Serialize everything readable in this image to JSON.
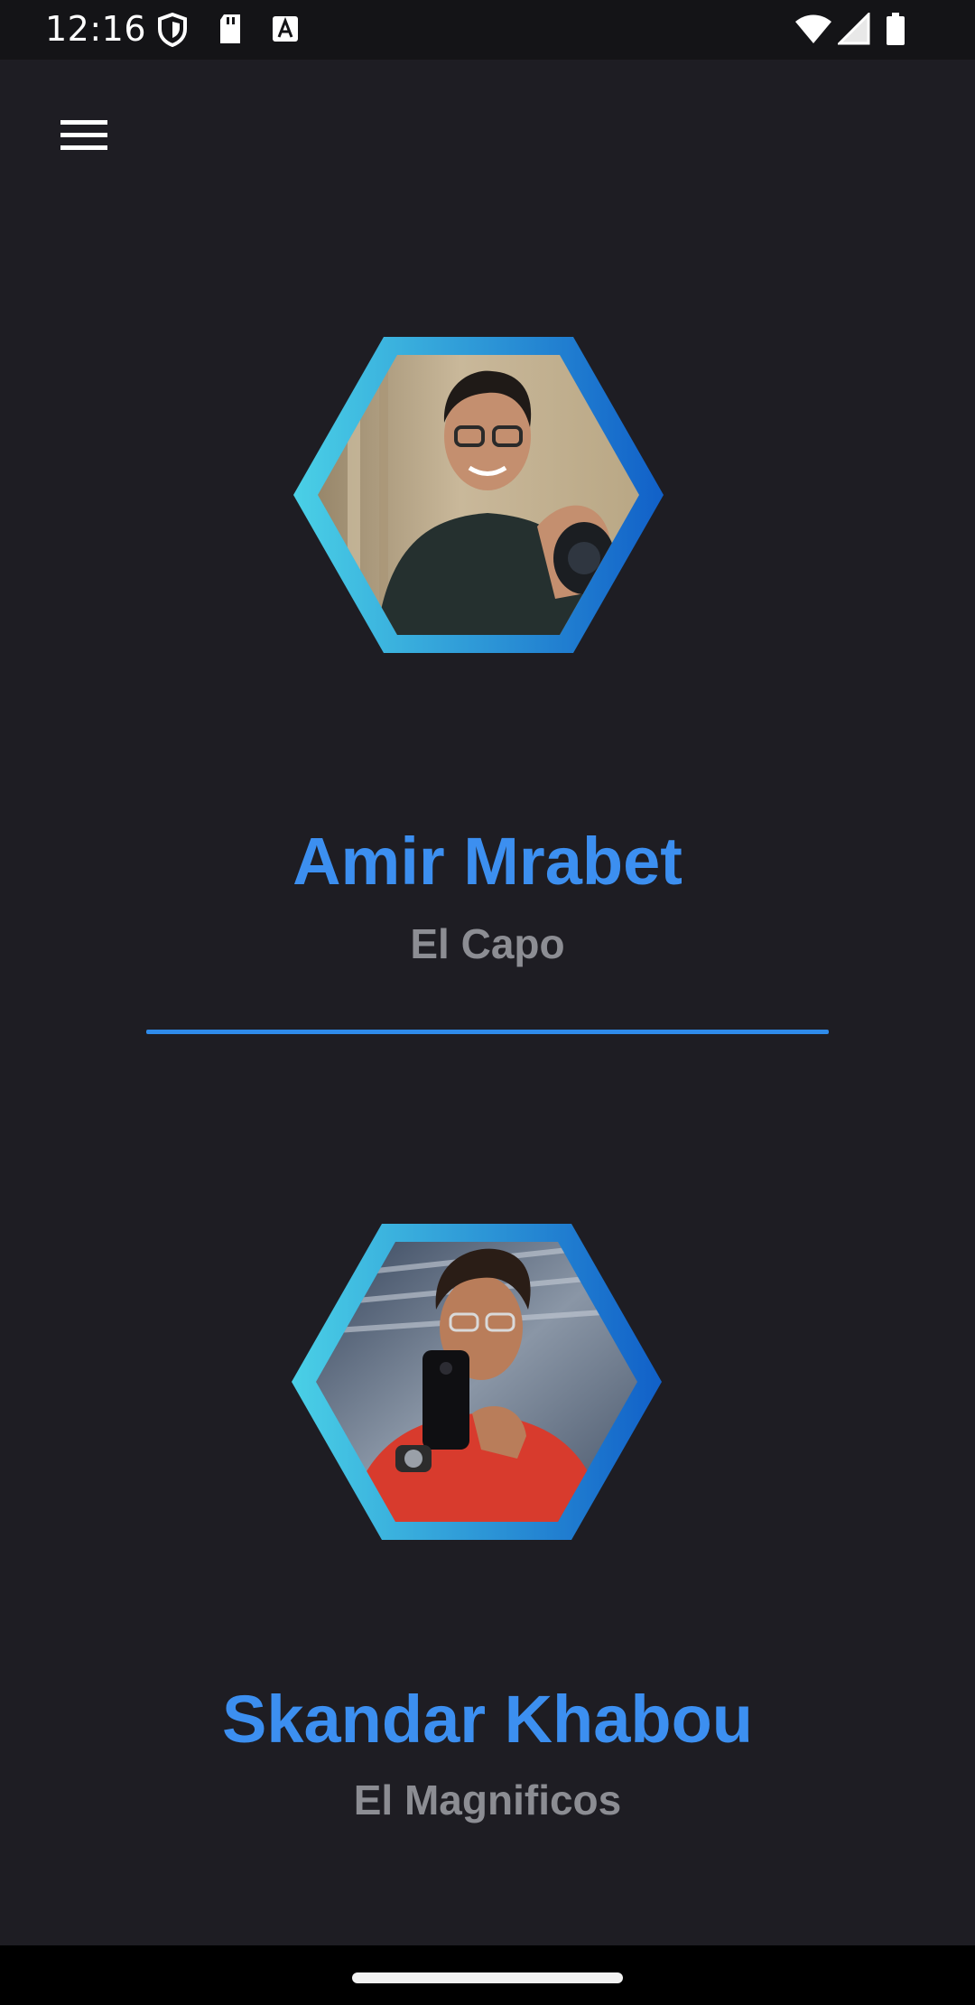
{
  "status_bar": {
    "time": "12:16",
    "left_icons": [
      "shield-icon",
      "sd-card-icon",
      "font-a-icon"
    ],
    "right_icons": [
      "wifi-icon",
      "signal-icon",
      "battery-icon"
    ]
  },
  "header": {
    "menu_icon": "hamburger-menu-icon"
  },
  "profiles": [
    {
      "name": "Amir Mrabet",
      "title": "El Capo",
      "photo": "avatar-photo-man-with-camera"
    },
    {
      "name": "Skandar Khabou",
      "title": "El Magnificos",
      "photo": "avatar-photo-man-mirror-selfie"
    }
  ],
  "colors": {
    "background": "#1e1d23",
    "accent": "#3c8ff0",
    "subtitle": "#8c8d93",
    "hex_gradient_start": "#4ad0e6",
    "hex_gradient_end": "#1160c8"
  }
}
